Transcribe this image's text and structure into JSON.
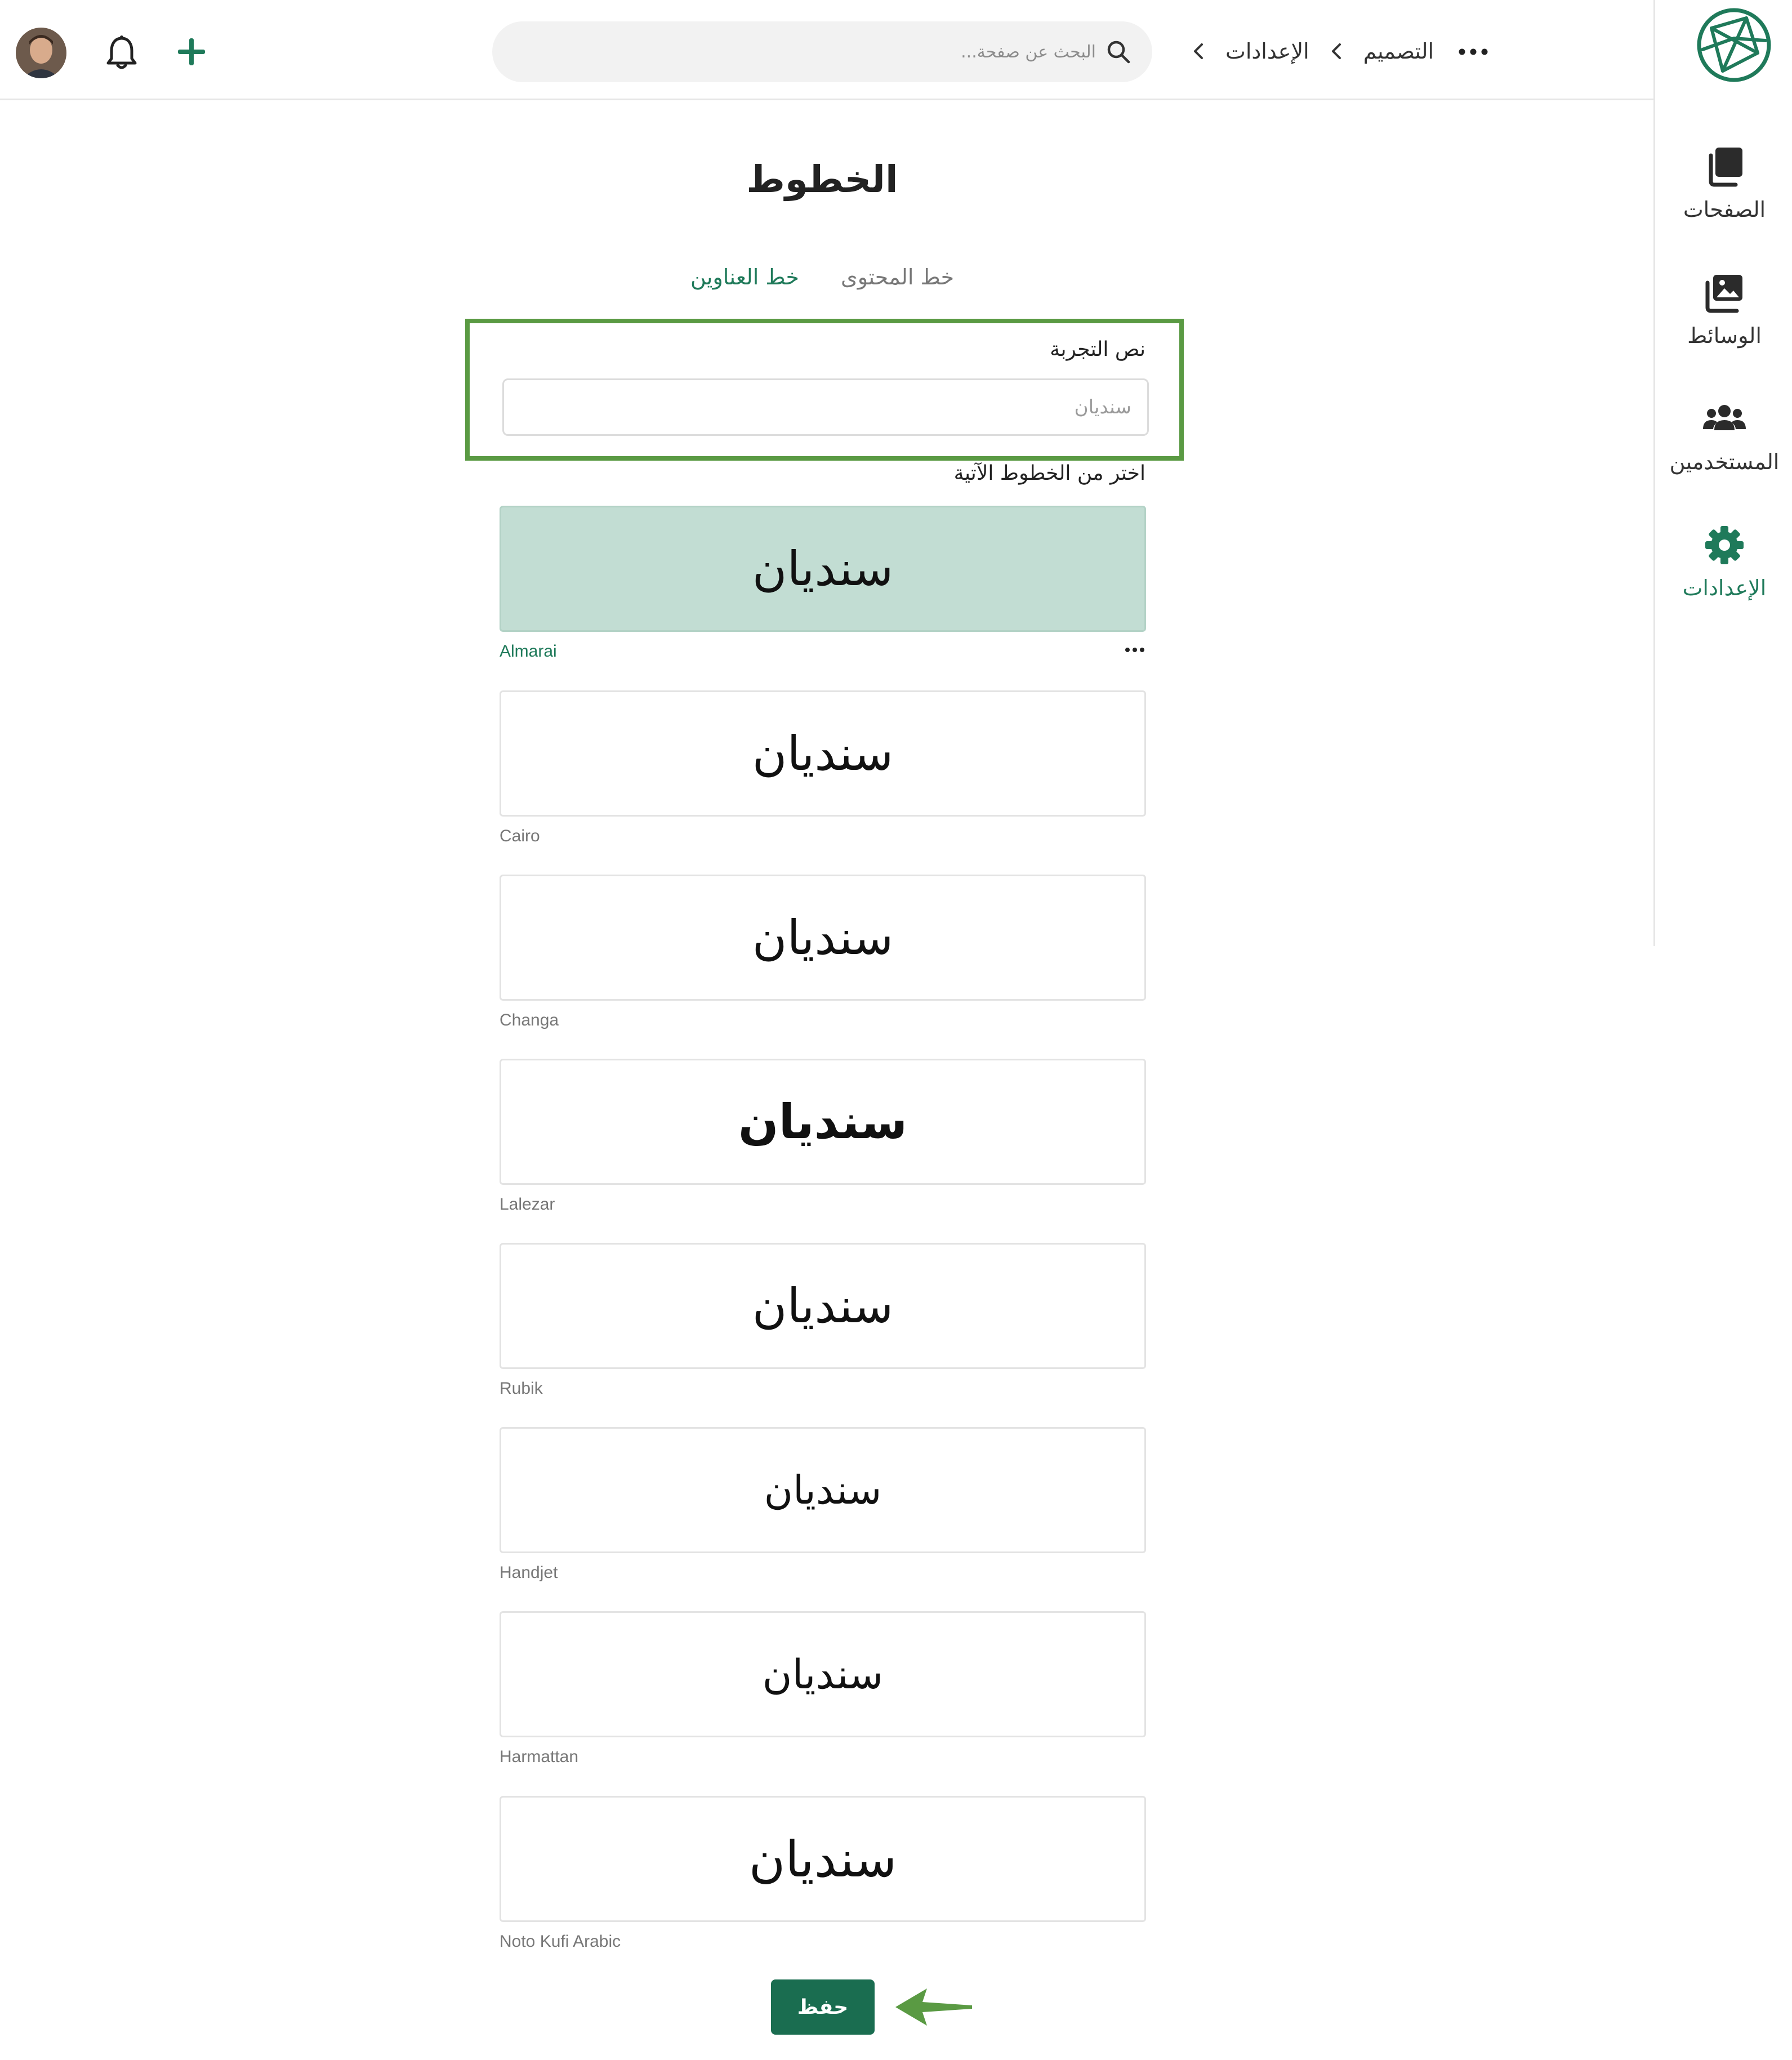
{
  "header": {
    "search_placeholder": "البحث عن صفحة...",
    "breadcrumbs": [
      "الإعدادات",
      "التصميم"
    ]
  },
  "sidebar": {
    "items": [
      {
        "label": "الصفحات",
        "icon": "pages-icon"
      },
      {
        "label": "الوسائط",
        "icon": "media-icon"
      },
      {
        "label": "المستخدمين",
        "icon": "users-icon"
      },
      {
        "label": "الإعدادات",
        "icon": "gear-icon",
        "active": true
      }
    ]
  },
  "main": {
    "title": "الخطوط",
    "tabs": [
      {
        "label": "خط العناوين",
        "active": true
      },
      {
        "label": "خط المحتوى",
        "active": false
      }
    ],
    "test_text": {
      "label": "نص التجربة",
      "placeholder": "سنديان"
    },
    "choose_label": "اختر من الخطوط الآتية",
    "fonts": [
      {
        "sample": "سنديان",
        "name": "Almarai",
        "selected": true
      },
      {
        "sample": "سنديان",
        "name": "Cairo"
      },
      {
        "sample": "سنديان",
        "name": "Changa"
      },
      {
        "sample": "سنديان",
        "name": "Lalezar"
      },
      {
        "sample": "سنديان",
        "name": "Rubik"
      },
      {
        "sample": "سنديان",
        "name": "Handjet"
      },
      {
        "sample": "سنديان",
        "name": "Harmattan"
      },
      {
        "sample": "سنديان",
        "name": "Noto Kufi Arabic"
      }
    ],
    "save_label": "حفظ"
  },
  "colors": {
    "accent": "#1f7a5a",
    "selected_card": "#c2ddd3",
    "highlight_box": "#5a9a43",
    "save_button": "#1a6d50"
  }
}
